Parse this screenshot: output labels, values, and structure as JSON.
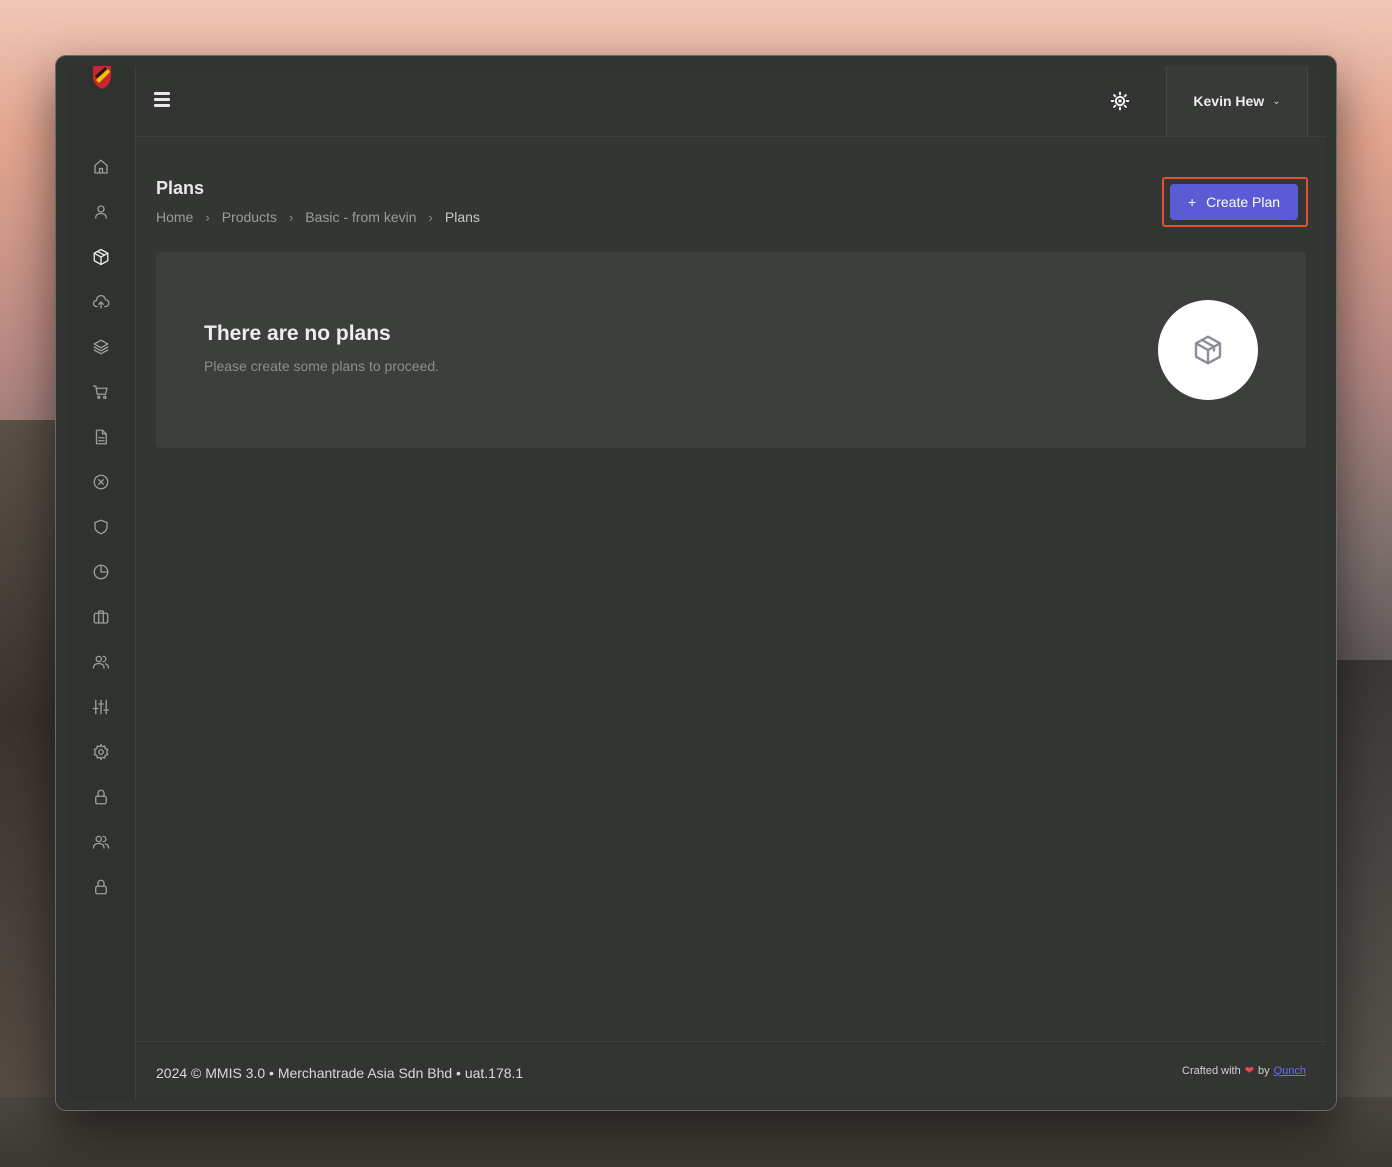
{
  "header": {
    "user_name": "Kevin Hew"
  },
  "page": {
    "title": "Plans",
    "breadcrumb": [
      "Home",
      "Products",
      "Basic - from kevin",
      "Plans"
    ],
    "create_button_label": "Create Plan",
    "create_button_icon": "+"
  },
  "empty_state": {
    "title": "There are no plans",
    "subtitle": "Please create some plans to proceed."
  },
  "sidebar": {
    "items": [
      {
        "icon": "home-icon"
      },
      {
        "icon": "user-icon"
      },
      {
        "icon": "box-icon",
        "active": true
      },
      {
        "icon": "cloud-upload-icon"
      },
      {
        "icon": "layers-icon"
      },
      {
        "icon": "cart-icon"
      },
      {
        "icon": "document-icon"
      },
      {
        "icon": "x-circle-icon"
      },
      {
        "icon": "shield-icon"
      },
      {
        "icon": "pie-chart-icon"
      },
      {
        "icon": "briefcase-icon"
      },
      {
        "icon": "users-icon"
      },
      {
        "icon": "sliders-icon"
      },
      {
        "icon": "gear-icon"
      },
      {
        "icon": "lock-icon"
      },
      {
        "icon": "users-icon"
      },
      {
        "icon": "lock-icon"
      }
    ]
  },
  "footer": {
    "copyright": "2024 © MMIS 3.0 • Merchantrade Asia Sdn Bhd • uat.178.1",
    "crafted_prefix": "Crafted with",
    "crafted_by": "by",
    "crafted_link": "Qunch"
  },
  "colors": {
    "primary_button": "#5b5bd6",
    "highlight_border": "#e2512e",
    "heart": "#e5484d"
  }
}
